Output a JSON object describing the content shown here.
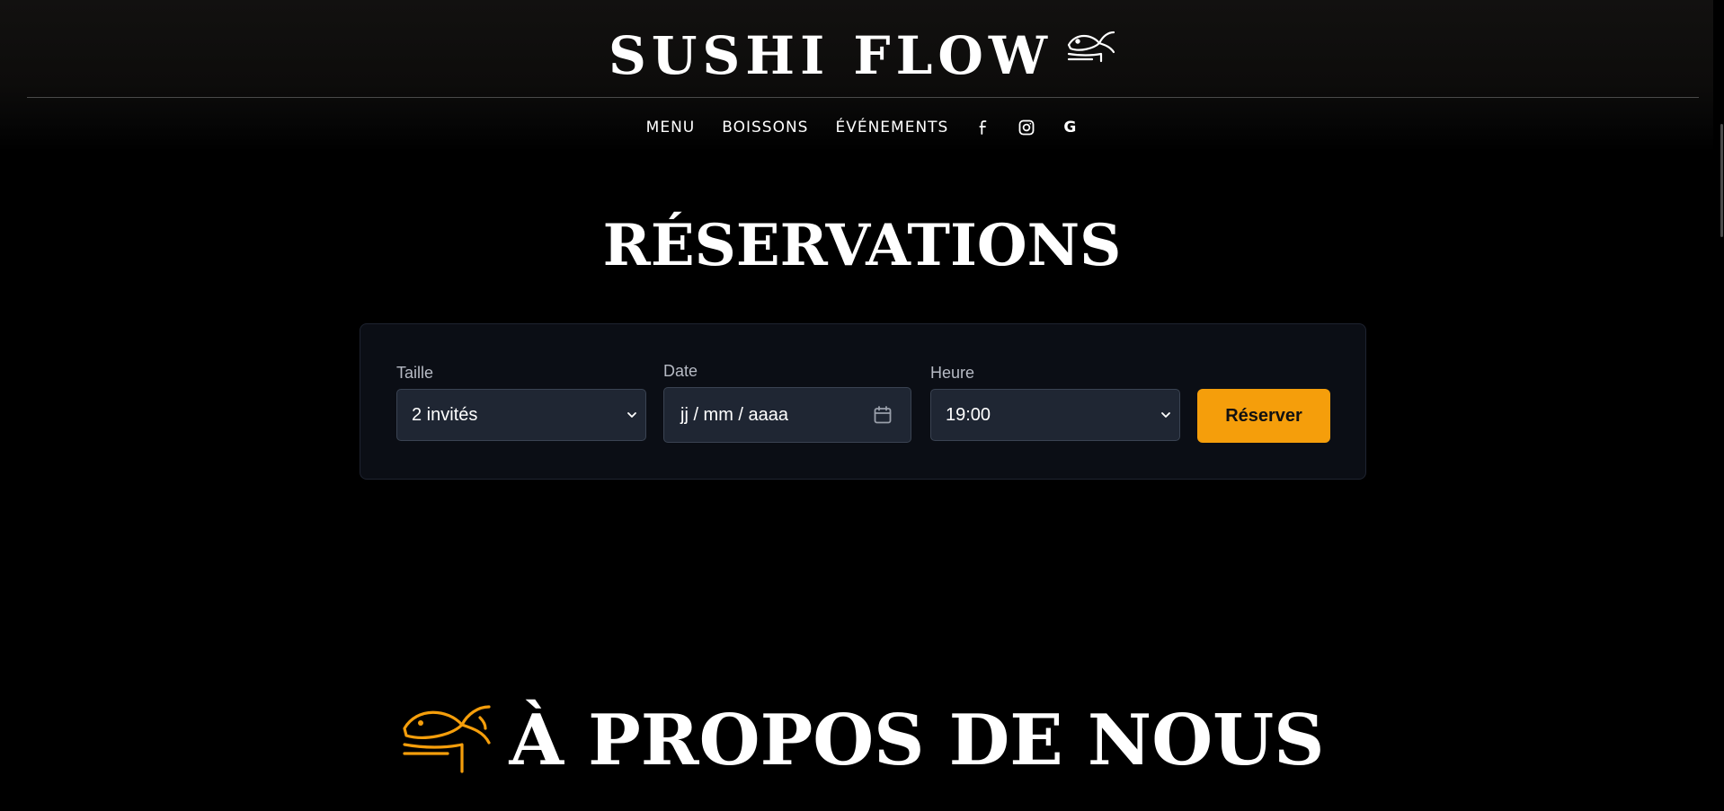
{
  "brand": {
    "title": "SUSHI FLOW",
    "logo_icon": "fish-icon"
  },
  "nav": {
    "links": [
      "MENU",
      "BOISSONS",
      "ÉVÉNEMENTS"
    ],
    "social_icons": [
      "facebook-icon",
      "instagram-icon",
      "google-icon"
    ],
    "google_glyph": "G"
  },
  "reservations": {
    "title": "RÉSERVATIONS",
    "size_label": "Taille",
    "size_value": "2 invités",
    "date_label": "Date",
    "date_placeholder": "jj / mm / aaaa",
    "time_label": "Heure",
    "time_value": "19:00",
    "submit_label": "Réserver"
  },
  "about": {
    "title": "À PROPOS DE NOUS",
    "icon": "fish-icon"
  },
  "colors": {
    "accent": "#f59e0b",
    "background": "#000000",
    "card": "#0b0e15",
    "field": "#1f2633",
    "text": "#ffffff"
  }
}
